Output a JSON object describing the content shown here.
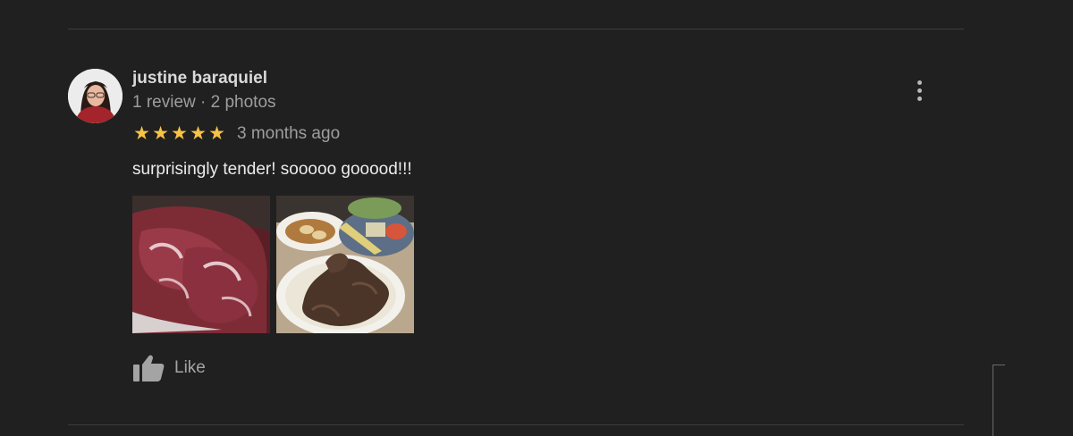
{
  "review": {
    "reviewer_name": "justine baraquiel",
    "reviewer_meta": "1 review · 2 photos",
    "rating": 5,
    "stars": [
      "★",
      "★",
      "★",
      "★",
      "★"
    ],
    "time_ago": "3 months ago",
    "text": "surprisingly tender! sooooo gooood!!!",
    "photo_count": 2,
    "like_label": "Like"
  },
  "icons": {
    "more": "more-vertical-icon",
    "like": "thumbs-up-icon",
    "star": "star-icon"
  },
  "colors": {
    "background": "#202020",
    "star": "#f6c344",
    "name": "#d9d9d9",
    "meta": "#9e9e9e",
    "text": "#ececec"
  }
}
